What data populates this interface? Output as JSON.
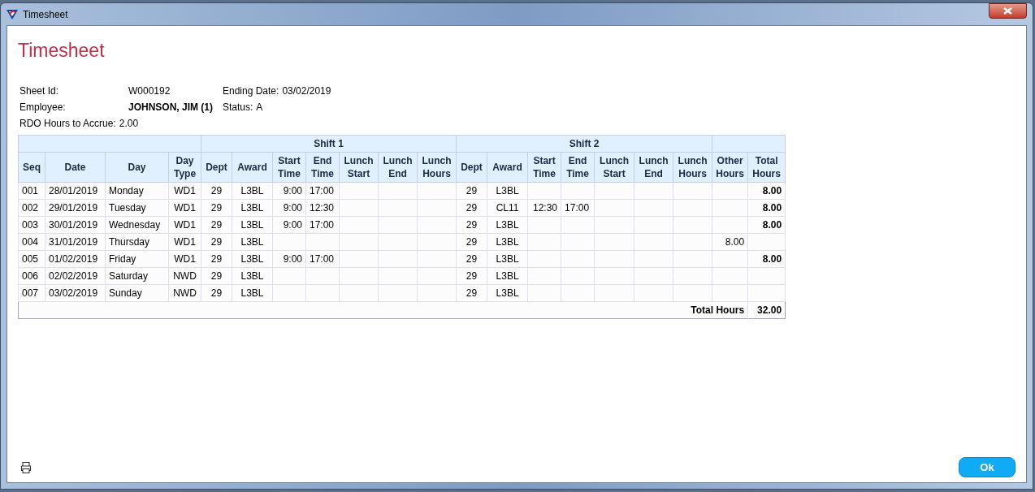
{
  "window": {
    "title": "Timesheet"
  },
  "heading": "Timesheet",
  "details": [
    {
      "label": "Sheet Id:",
      "value": "W000192"
    },
    {
      "label": "Ending Date:",
      "value": "03/02/2019"
    },
    {
      "label": "Employee:",
      "value": "JOHNSON, JIM (1)",
      "bold": true
    },
    {
      "label": "Status:",
      "value": "A"
    },
    {
      "label": "RDO Hours to Accrue:",
      "value": "2.00"
    }
  ],
  "table": {
    "column_groups": [
      {
        "label": "Shift 1"
      },
      {
        "label": "Shift 2"
      }
    ],
    "columns": [
      "Seq",
      "Date",
      "Day",
      "Day Type",
      "Dept",
      "Award",
      "Start Time",
      "End Time",
      "Lunch Start",
      "Lunch End",
      "Lunch Hours",
      "Dept",
      "Award",
      "Start Time",
      "End Time",
      "Lunch Start",
      "Lunch End",
      "Lunch Hours",
      "Other Hours",
      "Total Hours"
    ],
    "rows": [
      [
        "001",
        "28/01/2019",
        "Monday",
        "WD1",
        "29",
        "L3BL",
        "9:00",
        "17:00",
        null,
        null,
        null,
        "29",
        "L3BL",
        null,
        null,
        null,
        null,
        null,
        null,
        "8.00"
      ],
      [
        "002",
        "29/01/2019",
        "Tuesday",
        "WD1",
        "29",
        "L3BL",
        "9:00",
        "12:30",
        null,
        null,
        null,
        "29",
        "CL11",
        "12:30",
        "17:00",
        null,
        null,
        null,
        null,
        "8.00"
      ],
      [
        "003",
        "30/01/2019",
        "Wednesday",
        "WD1",
        "29",
        "L3BL",
        "9:00",
        "17:00",
        null,
        null,
        null,
        "29",
        "L3BL",
        null,
        null,
        null,
        null,
        null,
        null,
        "8.00"
      ],
      [
        "004",
        "31/01/2019",
        "Thursday",
        "WD1",
        "29",
        "L3BL",
        null,
        null,
        null,
        null,
        null,
        "29",
        "L3BL",
        null,
        null,
        null,
        null,
        null,
        "8.00",
        null
      ],
      [
        "005",
        "01/02/2019",
        "Friday",
        "WD1",
        "29",
        "L3BL",
        "9:00",
        "17:00",
        null,
        null,
        null,
        "29",
        "L3BL",
        null,
        null,
        null,
        null,
        null,
        null,
        "8.00"
      ],
      [
        "006",
        "02/02/2019",
        "Saturday",
        "NWD",
        "29",
        "L3BL",
        null,
        null,
        null,
        null,
        null,
        "29",
        "L3BL",
        null,
        null,
        null,
        null,
        null,
        null,
        null
      ],
      [
        "007",
        "03/02/2019",
        "Sunday",
        "NWD",
        "29",
        "L3BL",
        null,
        null,
        null,
        null,
        null,
        "29",
        "L3BL",
        null,
        null,
        null,
        null,
        null,
        null,
        null
      ]
    ],
    "total": {
      "label": "Total Hours",
      "value": "32.00"
    }
  },
  "buttons": [
    "Ok"
  ]
}
